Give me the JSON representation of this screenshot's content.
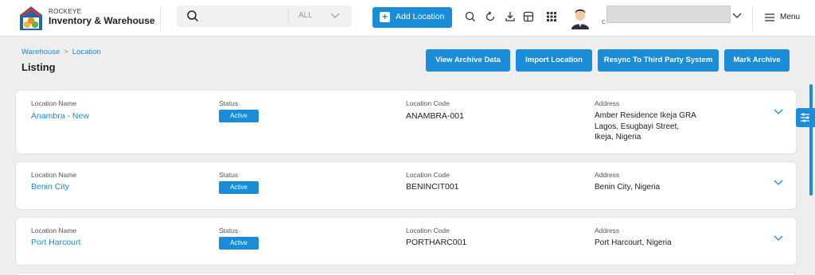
{
  "header": {
    "brand_small": "ROCKEYE",
    "brand_title": "Inventory & Warehouse",
    "search_placeholder": "",
    "search_scope": "ALL",
    "add_label": "Add Location",
    "user_sub": "C",
    "menu_label": "Menu",
    "icons": [
      "search-icon",
      "refresh-icon",
      "download-icon",
      "grid-view-icon",
      "apps-icon"
    ]
  },
  "breadcrumb": [
    "Warehouse",
    "Location"
  ],
  "page_title": "Listing",
  "actions": [
    "View Archive Data",
    "Import Location",
    "Resync To Third Party System",
    "Mark Archive"
  ],
  "columns": {
    "name": "Location Name",
    "status": "Status",
    "code": "Location Code",
    "address": "Address"
  },
  "locations": [
    {
      "name": "Anambra - New",
      "status": "Active",
      "code": "ANAMBRA-001",
      "address": "Amber Residence Ikeja GRA Lagos, Esugbayi Street, Ikeja, Nigeria"
    },
    {
      "name": "Benin City",
      "status": "Active",
      "code": "BENINCIT001",
      "address": "Benin City, Nigeria"
    },
    {
      "name": "Port Harcourt",
      "status": "Active",
      "code": "PORTHARC001",
      "address": "Port Harcourt, Nigeria"
    }
  ],
  "colors": {
    "accent": "#1a8cd8",
    "background": "#eeeeee"
  }
}
